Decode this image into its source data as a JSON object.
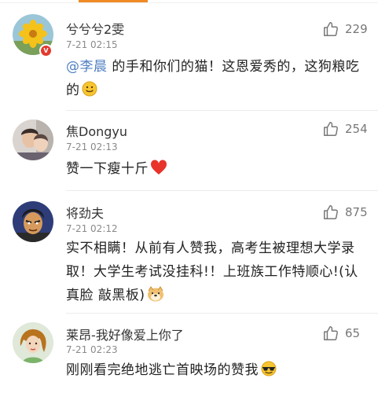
{
  "comments": [
    {
      "username": "兮兮兮2雯",
      "time": "7-21 02:15",
      "likes": "229",
      "mention": "@李晨",
      "text": " 的手和你们的猫！这恩爱秀的，这狗粮吃的"
    },
    {
      "username": "焦Dongyu",
      "time": "7-21 02:13",
      "likes": "254",
      "text": "赞一下瘦十斤"
    },
    {
      "username": "将劲夫",
      "time": "7-21 02:12",
      "likes": "875",
      "text": "实不相瞒！从前有人赞我，高考生被理想大学录取！大学生考试没挂科!！上班族工作特顺心!(认真脸 敲黑板)"
    },
    {
      "username": "莱昂-我好像爱上你了",
      "time": "7-21 02:23",
      "likes": "65",
      "text": "刚刚看完绝地逃亡首映场的赞我"
    }
  ],
  "colors": {
    "mention": "#4f7fc2",
    "accent": "#f08a24",
    "badge": "#e23a2e"
  },
  "icons": {
    "like": "thumbs-up-outline-icon",
    "emojis": [
      "smiley-face-icon",
      "red-heart-icon",
      "doge-face-icon",
      "cool-sunglasses-face-icon"
    ]
  }
}
